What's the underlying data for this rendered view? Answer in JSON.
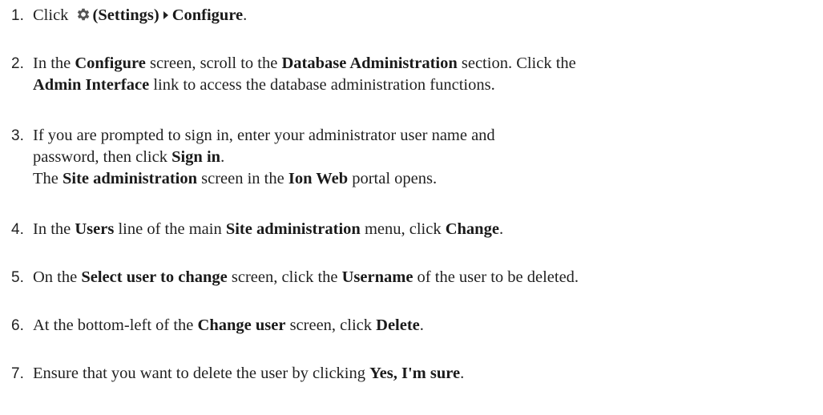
{
  "steps": [
    {
      "num": "1.",
      "parts": [
        {
          "t": "Click "
        },
        {
          "icon": "gear-icon"
        },
        {
          "b": "(Settings)"
        },
        {
          "icon": "caret-right-icon"
        },
        {
          "b": "Configure"
        },
        {
          "t": "."
        }
      ]
    },
    {
      "num": "2.",
      "parts": [
        {
          "t": "In the "
        },
        {
          "b": "Configure"
        },
        {
          "t": " screen, scroll to the "
        },
        {
          "b": "Database Administration"
        },
        {
          "t": " section. Click the"
        },
        {
          "br": true
        },
        {
          "b": "Admin Interface"
        },
        {
          "t": " link to access the database administration functions."
        }
      ]
    },
    {
      "num": "3.",
      "parts": [
        {
          "t": "If you are prompted to sign in, enter your administrator user name and"
        },
        {
          "br": true
        },
        {
          "t": "password, then click "
        },
        {
          "b": "Sign in"
        },
        {
          "t": "."
        },
        {
          "br": true
        },
        {
          "t": "The "
        },
        {
          "b": "Site administration"
        },
        {
          "t": " screen in the "
        },
        {
          "b": "Ion Web"
        },
        {
          "t": " portal opens."
        }
      ]
    },
    {
      "num": "4.",
      "parts": [
        {
          "t": "In the "
        },
        {
          "b": "Users"
        },
        {
          "t": " line of the main "
        },
        {
          "b": "Site administration"
        },
        {
          "t": " menu, click "
        },
        {
          "b": "Change"
        },
        {
          "t": "."
        }
      ]
    },
    {
      "num": "5.",
      "parts": [
        {
          "t": "On the "
        },
        {
          "b": "Select user to change"
        },
        {
          "t": " screen, click the "
        },
        {
          "b": "Username"
        },
        {
          "t": " of the user to be deleted."
        }
      ]
    },
    {
      "num": "6.",
      "parts": [
        {
          "t": "At the bottom-left of the "
        },
        {
          "b": "Change user"
        },
        {
          "t": " screen, click "
        },
        {
          "b": "Delete"
        },
        {
          "t": "."
        }
      ]
    },
    {
      "num": "7.",
      "parts": [
        {
          "t": "Ensure that you want to delete the user by clicking "
        },
        {
          "b": "Yes, I'm sure"
        },
        {
          "t": "."
        }
      ]
    }
  ]
}
